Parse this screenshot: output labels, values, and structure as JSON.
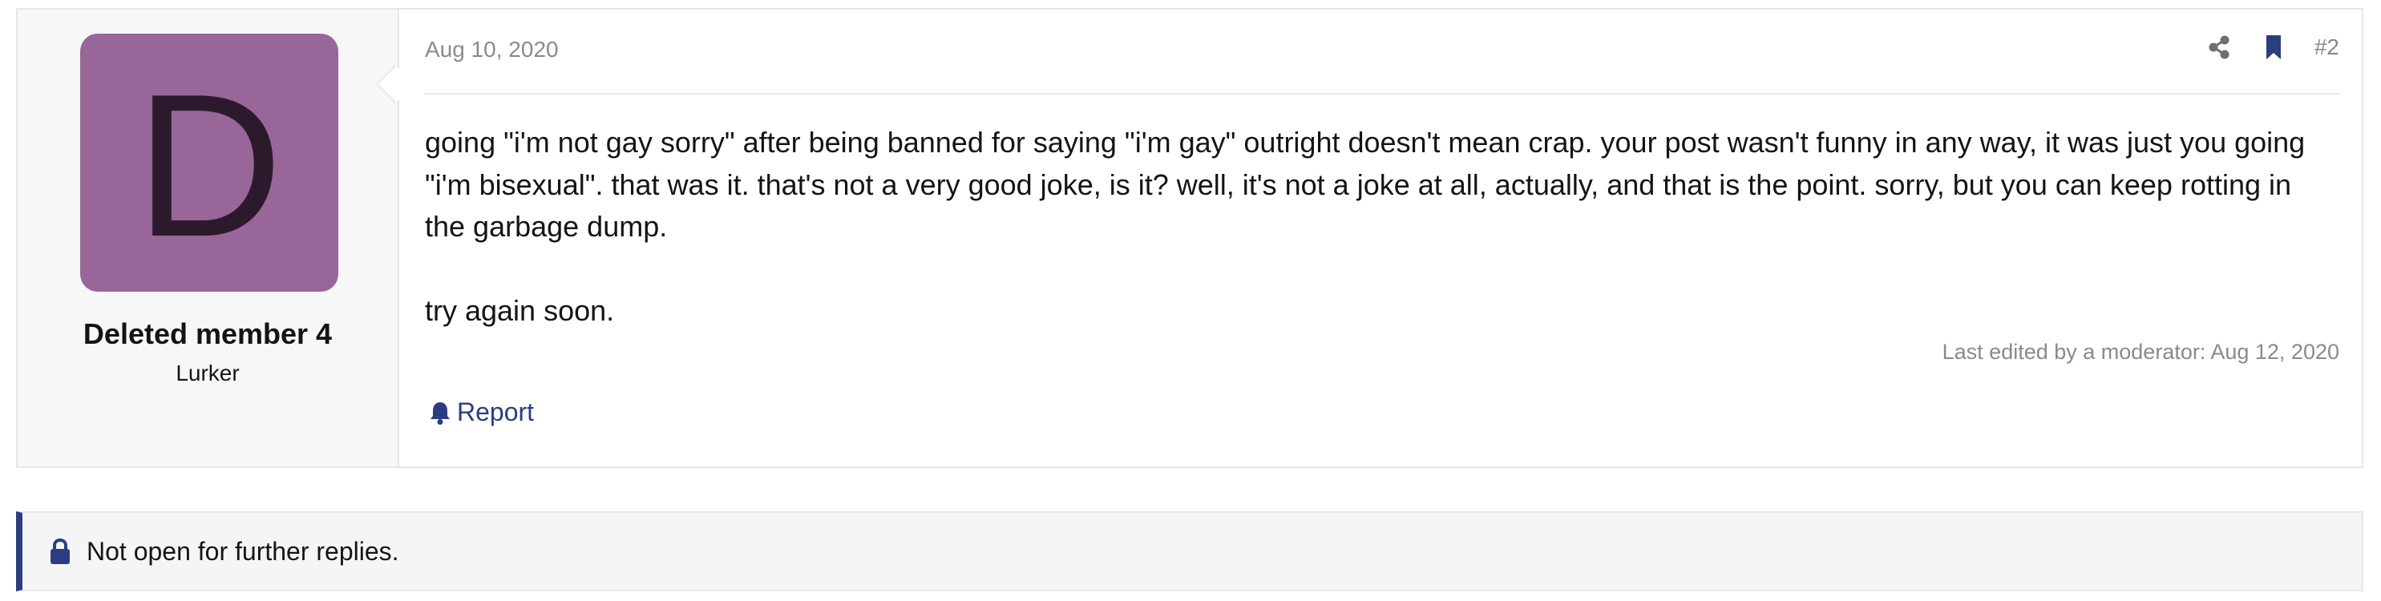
{
  "post": {
    "user": {
      "avatar_letter": "D",
      "avatar_color": "#996699",
      "name": "Deleted member 4",
      "title": "Lurker"
    },
    "date": "Aug 10, 2020",
    "number": "#2",
    "actions": [
      "share-icon",
      "bookmark-icon"
    ],
    "body": {
      "paragraph1": "going \"i'm not gay sorry\" after being banned for saying \"i'm gay\" outright doesn't mean crap. your post wasn't funny in any way, it was just you going \"i'm bisexual\". that was it. that's not a very good joke, is it? well, it's not a joke at all, actually, and that is the point. sorry, but you can keep rotting in the garbage dump.",
      "paragraph2": "try again soon."
    },
    "edit_note": "Last edited by a moderator: Aug 12, 2020",
    "report_label": "Report"
  },
  "notice": {
    "text": "Not open for further replies.",
    "icon": "lock-icon"
  },
  "colors": {
    "accent": "#2a3e80",
    "muted_text": "#8a8a8a",
    "avatar_bg": "#996699"
  }
}
